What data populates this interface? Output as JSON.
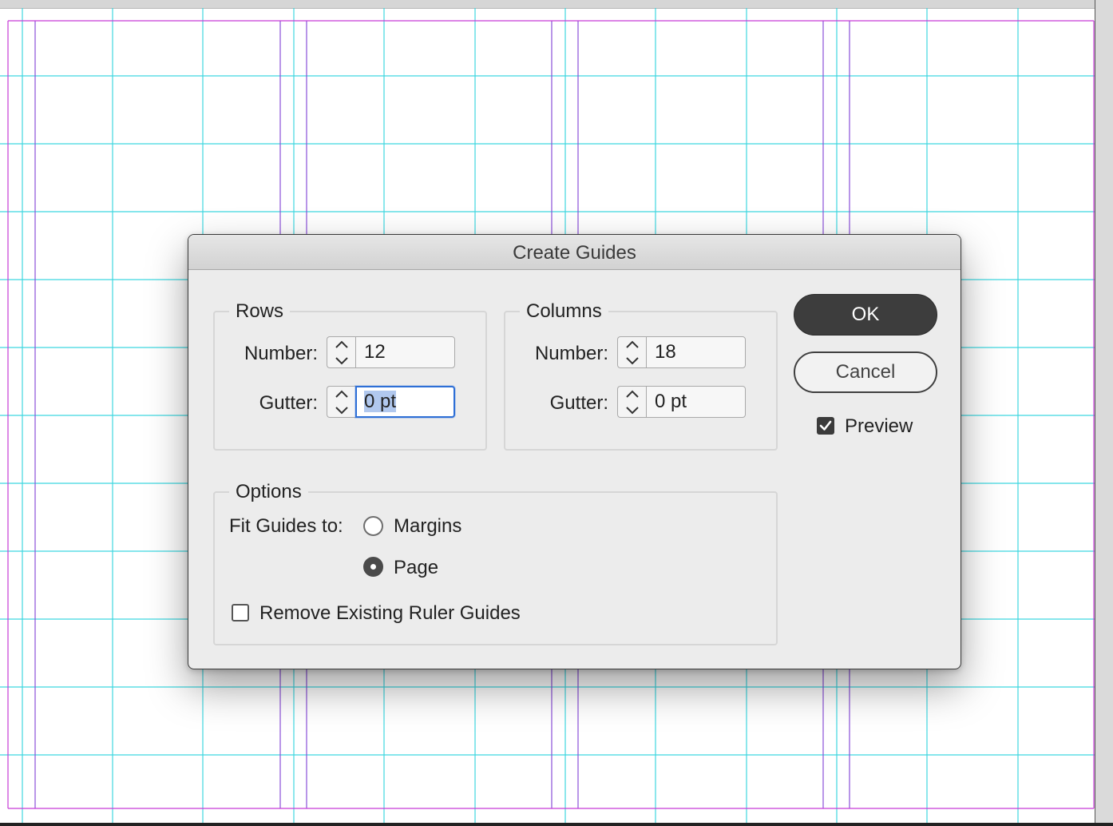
{
  "dialog": {
    "title": "Create Guides",
    "rows": {
      "legend": "Rows",
      "number_label": "Number:",
      "number_value": "12",
      "gutter_label": "Gutter:",
      "gutter_value": "0 pt"
    },
    "columns": {
      "legend": "Columns",
      "number_label": "Number:",
      "number_value": "18",
      "gutter_label": "Gutter:",
      "gutter_value": "0 pt"
    },
    "options": {
      "legend": "Options",
      "fit_label": "Fit Guides to:",
      "fit_choices": [
        {
          "label": "Margins",
          "selected": false
        },
        {
          "label": "Page",
          "selected": true
        }
      ],
      "remove_label": "Remove Existing Ruler Guides",
      "remove_checked": false
    },
    "ok_label": "OK",
    "cancel_label": "Cancel",
    "preview_label": "Preview",
    "preview_checked": true
  },
  "colors": {
    "guide_cyan": "#3fd7e0",
    "margin_magenta": "#c63bd6",
    "column_violet": "#8a4fd8",
    "focus_blue": "#2e6fd6",
    "primary_button": "#3d3d3d"
  }
}
